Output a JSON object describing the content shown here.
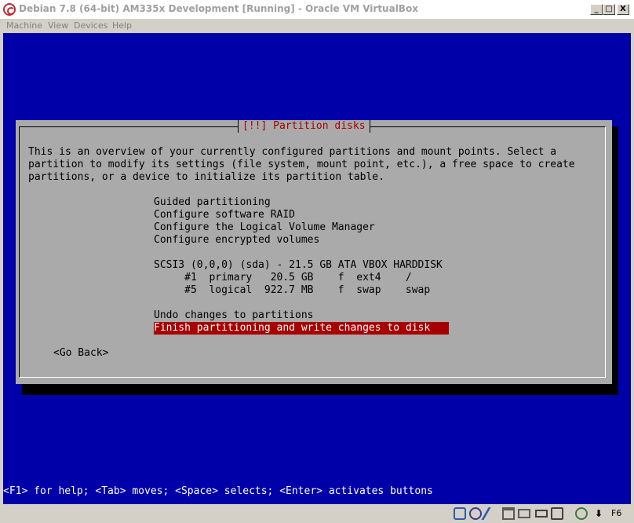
{
  "window": {
    "title": "Debian 7.8 (64-bit) AM335x Development [Running] - Oracle VM VirtualBox",
    "min_glyph": "_",
    "max_glyph": "□",
    "close_glyph": "X"
  },
  "menu": [
    "Machine",
    "View",
    "Devices",
    "Help"
  ],
  "dialog": {
    "title": "[!!] Partition disks",
    "intro": [
      "This is an overview of your currently configured partitions and mount points. Select a",
      "partition to modify its settings (file system, mount point, etc.), a free space to create",
      "partitions, or a device to initialize its partition table."
    ],
    "options": [
      "Guided partitioning",
      "Configure software RAID",
      "Configure the Logical Volume Manager",
      "Configure encrypted volumes"
    ],
    "disk": "SCSI3 (0,0,0) (sda) - 21.5 GB ATA VBOX HARDDISK",
    "partitions": [
      "     #1  primary   20.5 GB    f  ext4    /",
      "     #5  logical  922.7 MB    f  swap    swap"
    ],
    "undo": "Undo changes to partitions",
    "finish": "Finish partitioning and write changes to disk                         ",
    "go_back": "<Go Back>"
  },
  "footer": "<F1> for help; <Tab> moves; <Space> selects; <Enter> activates buttons",
  "statusbar": {
    "host_key": "F6",
    "icons": [
      "hard-disk-icon",
      "optical-drive-icon",
      "usb-icon",
      "shared-folders-icon",
      "display-icon",
      "network-icon",
      "capture-icon",
      "host-key-icon"
    ]
  },
  "colors": {
    "screen_bg": "#0000a8",
    "dialog_bg": "#aaaaaa",
    "highlight": "#a80000",
    "title_red": "#a80000"
  }
}
